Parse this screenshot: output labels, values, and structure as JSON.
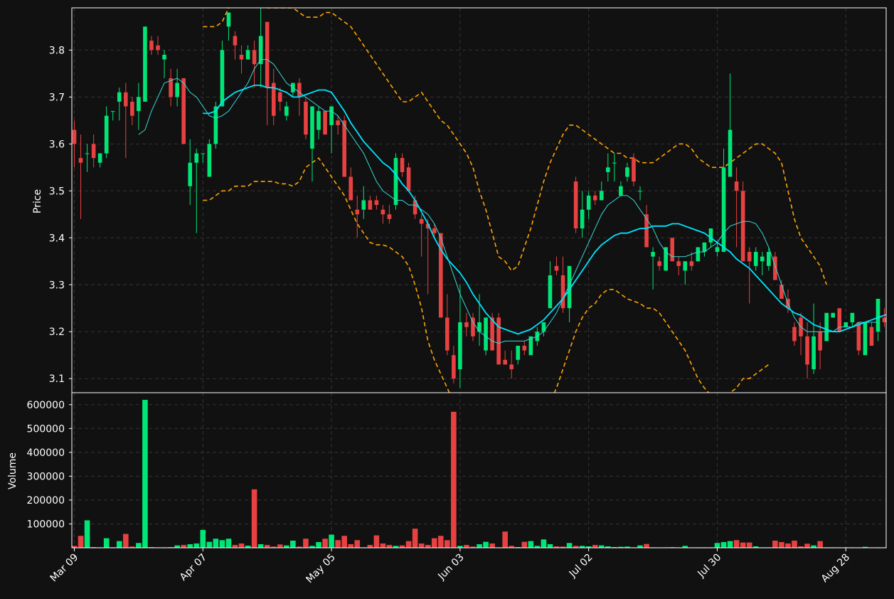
{
  "colors": {
    "background": "#111111",
    "up": "#00e676",
    "down": "#e84142",
    "ma_fast": "#38d9d9",
    "ma_slow": "#00e5ff",
    "bands": "#ffa500",
    "grid": "#333333",
    "axis": "#ffffff"
  },
  "chart_data": {
    "type": "candlestick",
    "price_panel": {
      "ylabel": "Price",
      "ylim": [
        3.07,
        3.89
      ],
      "yticks": [
        "3.1",
        "3.2",
        "3.3",
        "3.4",
        "3.5",
        "3.6",
        "3.7",
        "3.8"
      ],
      "grid": true
    },
    "volume_panel": {
      "ylabel": "Volume",
      "ylim": [
        0,
        650000
      ],
      "yticks": [
        "100000",
        "200000",
        "300000",
        "400000",
        "500000",
        "600000"
      ],
      "grid": true
    },
    "xtick_labels": [
      "Mar 09",
      "Apr 07",
      "May 05",
      "Jun 03",
      "Jul 02",
      "Jul 30",
      "Aug 28"
    ],
    "xtick_index": [
      0,
      20,
      40,
      60,
      80,
      100,
      120
    ],
    "candles": [
      [
        3.63,
        3.65,
        3.55,
        3.6
      ],
      [
        3.57,
        3.62,
        3.44,
        3.56
      ],
      [
        3.58,
        3.6,
        3.54,
        3.58
      ],
      [
        3.6,
        3.62,
        3.55,
        3.57
      ],
      [
        3.56,
        3.58,
        3.55,
        3.58
      ],
      [
        3.58,
        3.68,
        3.57,
        3.66
      ],
      [
        3.67,
        3.67,
        3.65,
        3.67
      ],
      [
        3.69,
        3.72,
        3.65,
        3.71
      ],
      [
        3.71,
        3.73,
        3.57,
        3.68
      ],
      [
        3.69,
        3.7,
        3.64,
        3.66
      ],
      [
        3.67,
        3.73,
        3.63,
        3.7
      ],
      [
        3.69,
        3.85,
        3.69,
        3.85
      ],
      [
        3.82,
        3.83,
        3.79,
        3.8
      ],
      [
        3.81,
        3.83,
        3.79,
        3.8
      ],
      [
        3.78,
        3.8,
        3.74,
        3.79
      ],
      [
        3.74,
        3.76,
        3.68,
        3.7
      ],
      [
        3.7,
        3.76,
        3.68,
        3.73
      ],
      [
        3.74,
        3.74,
        3.6,
        3.6
      ],
      [
        3.51,
        3.61,
        3.47,
        3.56
      ],
      [
        3.56,
        3.59,
        3.41,
        3.58
      ],
      [
        3.58,
        3.58,
        3.56,
        3.58
      ],
      [
        3.53,
        3.61,
        3.53,
        3.6
      ],
      [
        3.6,
        3.69,
        3.59,
        3.68
      ],
      [
        3.68,
        3.82,
        3.68,
        3.8
      ],
      [
        3.85,
        3.88,
        3.82,
        3.88
      ],
      [
        3.83,
        3.84,
        3.78,
        3.81
      ],
      [
        3.79,
        3.81,
        3.75,
        3.78
      ],
      [
        3.78,
        3.81,
        3.78,
        3.8
      ],
      [
        3.8,
        3.82,
        3.72,
        3.77
      ],
      [
        3.77,
        3.89,
        3.72,
        3.83
      ],
      [
        3.86,
        3.86,
        3.64,
        3.72
      ],
      [
        3.73,
        3.76,
        3.64,
        3.66
      ],
      [
        3.71,
        3.72,
        3.67,
        3.69
      ],
      [
        3.66,
        3.69,
        3.65,
        3.68
      ],
      [
        3.71,
        3.73,
        3.7,
        3.73
      ],
      [
        3.73,
        3.74,
        3.66,
        3.7
      ],
      [
        3.69,
        3.7,
        3.61,
        3.62
      ],
      [
        3.59,
        3.68,
        3.52,
        3.68
      ],
      [
        3.63,
        3.68,
        3.61,
        3.67
      ],
      [
        3.67,
        3.67,
        3.62,
        3.62
      ],
      [
        3.64,
        3.66,
        3.58,
        3.68
      ],
      [
        3.65,
        3.66,
        3.62,
        3.64
      ],
      [
        3.65,
        3.66,
        3.53,
        3.53
      ],
      [
        3.53,
        3.55,
        3.48,
        3.48
      ],
      [
        3.46,
        3.49,
        3.4,
        3.45
      ],
      [
        3.46,
        3.51,
        3.44,
        3.48
      ],
      [
        3.48,
        3.49,
        3.46,
        3.46
      ],
      [
        3.48,
        3.49,
        3.46,
        3.47
      ],
      [
        3.46,
        3.47,
        3.43,
        3.45
      ],
      [
        3.45,
        3.47,
        3.43,
        3.44
      ],
      [
        3.47,
        3.58,
        3.46,
        3.57
      ],
      [
        3.57,
        3.58,
        3.53,
        3.54
      ],
      [
        3.55,
        3.56,
        3.5,
        3.5
      ],
      [
        3.48,
        3.49,
        3.44,
        3.45
      ],
      [
        3.44,
        3.45,
        3.36,
        3.43
      ],
      [
        3.43,
        3.44,
        3.28,
        3.42
      ],
      [
        3.42,
        3.43,
        3.4,
        3.41
      ],
      [
        3.41,
        3.41,
        3.29,
        3.23
      ],
      [
        3.23,
        3.28,
        3.15,
        3.16
      ],
      [
        3.15,
        3.17,
        3.09,
        3.1
      ],
      [
        3.12,
        3.3,
        3.08,
        3.22
      ],
      [
        3.22,
        3.24,
        3.19,
        3.21
      ],
      [
        3.23,
        3.24,
        3.18,
        3.19
      ],
      [
        3.2,
        3.28,
        3.17,
        3.22
      ],
      [
        3.16,
        3.23,
        3.15,
        3.23
      ],
      [
        3.23,
        3.24,
        3.16,
        3.16
      ],
      [
        3.23,
        3.24,
        3.13,
        3.13
      ],
      [
        3.14,
        3.16,
        3.13,
        3.13
      ],
      [
        3.13,
        3.16,
        3.1,
        3.12
      ],
      [
        3.14,
        3.17,
        3.13,
        3.17
      ],
      [
        3.17,
        3.18,
        3.15,
        3.16
      ],
      [
        3.15,
        3.19,
        3.15,
        3.19
      ],
      [
        3.18,
        3.21,
        3.17,
        3.2
      ],
      [
        3.2,
        3.22,
        3.19,
        3.22
      ],
      [
        3.25,
        3.35,
        3.25,
        3.32
      ],
      [
        3.34,
        3.36,
        3.32,
        3.33
      ],
      [
        3.32,
        3.36,
        3.24,
        3.25
      ],
      [
        3.25,
        3.34,
        3.22,
        3.34
      ],
      [
        3.52,
        3.53,
        3.41,
        3.42
      ],
      [
        3.42,
        3.5,
        3.4,
        3.46
      ],
      [
        3.46,
        3.5,
        3.44,
        3.49
      ],
      [
        3.49,
        3.5,
        3.47,
        3.48
      ],
      [
        3.48,
        3.52,
        3.48,
        3.5
      ],
      [
        3.54,
        3.58,
        3.52,
        3.55
      ],
      [
        3.56,
        3.58,
        3.52,
        3.56
      ],
      [
        3.49,
        3.52,
        3.49,
        3.51
      ],
      [
        3.53,
        3.56,
        3.52,
        3.55
      ],
      [
        3.57,
        3.58,
        3.51,
        3.52
      ],
      [
        3.5,
        3.51,
        3.48,
        3.5
      ],
      [
        3.45,
        3.47,
        3.38,
        3.38
      ],
      [
        3.36,
        3.38,
        3.29,
        3.37
      ],
      [
        3.35,
        3.36,
        3.33,
        3.34
      ],
      [
        3.33,
        3.38,
        3.33,
        3.38
      ],
      [
        3.4,
        3.4,
        3.35,
        3.35
      ],
      [
        3.35,
        3.36,
        3.32,
        3.34
      ],
      [
        3.33,
        3.35,
        3.3,
        3.35
      ],
      [
        3.35,
        3.37,
        3.33,
        3.34
      ],
      [
        3.35,
        3.38,
        3.35,
        3.38
      ],
      [
        3.37,
        3.39,
        3.36,
        3.39
      ],
      [
        3.39,
        3.42,
        3.38,
        3.42
      ],
      [
        3.37,
        3.39,
        3.36,
        3.38
      ],
      [
        3.37,
        3.59,
        3.37,
        3.55
      ],
      [
        3.53,
        3.75,
        3.53,
        3.63
      ],
      [
        3.52,
        3.55,
        3.38,
        3.5
      ],
      [
        3.5,
        3.52,
        3.35,
        3.35
      ],
      [
        3.37,
        3.38,
        3.26,
        3.35
      ],
      [
        3.34,
        3.38,
        3.33,
        3.37
      ],
      [
        3.35,
        3.37,
        3.32,
        3.36
      ],
      [
        3.34,
        3.38,
        3.33,
        3.37
      ],
      [
        3.36,
        3.37,
        3.31,
        3.31
      ],
      [
        3.3,
        3.31,
        3.27,
        3.27
      ],
      [
        3.27,
        3.29,
        3.24,
        3.25
      ],
      [
        3.21,
        3.22,
        3.17,
        3.18
      ],
      [
        3.23,
        3.24,
        3.15,
        3.19
      ],
      [
        3.19,
        3.22,
        3.1,
        3.13
      ],
      [
        3.12,
        3.26,
        3.11,
        3.19
      ],
      [
        3.2,
        3.22,
        3.12,
        3.16
      ],
      [
        3.18,
        3.24,
        3.18,
        3.24
      ],
      [
        3.23,
        3.24,
        3.23,
        3.24
      ],
      [
        3.25,
        3.25,
        3.2,
        3.2
      ],
      [
        3.21,
        3.22,
        3.21,
        3.22
      ],
      [
        3.22,
        3.24,
        3.21,
        3.24
      ],
      [
        3.22,
        3.22,
        3.15,
        3.16
      ],
      [
        3.15,
        3.22,
        3.15,
        3.22
      ],
      [
        3.21,
        3.22,
        3.17,
        3.17
      ],
      [
        3.2,
        3.27,
        3.18,
        3.27
      ],
      [
        3.23,
        3.25,
        3.21,
        3.22
      ],
      [
        3.19,
        3.21,
        3.17,
        3.18
      ],
      [
        3.16,
        3.2,
        3.16,
        3.19
      ]
    ],
    "volume": [
      8000,
      50000,
      115000,
      3000,
      2000,
      40000,
      2000,
      28000,
      58000,
      5000,
      20000,
      620000,
      3000,
      2000,
      2000,
      3000,
      10000,
      12000,
      15000,
      18000,
      75000,
      25000,
      38000,
      32000,
      38000,
      12000,
      18000,
      9000,
      245000,
      15000,
      12000,
      5000,
      14000,
      10000,
      30000,
      5000,
      38000,
      8000,
      24000,
      38000,
      55000,
      32000,
      50000,
      15000,
      32000,
      2000,
      12000,
      52000,
      18000,
      12000,
      8000,
      10000,
      28000,
      80000,
      18000,
      12000,
      40000,
      50000,
      32000,
      570000,
      8000,
      12000,
      5000,
      15000,
      25000,
      18000,
      2000,
      68000,
      8000,
      3000,
      25000,
      28000,
      8000,
      35000,
      15000,
      6000,
      5000,
      20000,
      8000,
      8000,
      6000,
      12000,
      10000,
      6000,
      3000,
      4000,
      5000,
      2000,
      10000,
      16000,
      2000,
      2000,
      2000,
      3000,
      2000,
      8000,
      2000,
      2000,
      2000,
      2000,
      20000,
      24000,
      28000,
      32000,
      22000,
      22000,
      6000,
      2000,
      2000,
      30000,
      24000,
      18000,
      30000,
      6000,
      17000,
      10000,
      28000,
      2000,
      2000,
      2000,
      2000,
      2000,
      2000,
      4000,
      2000,
      2000,
      2000,
      2000,
      2000,
      2000
    ],
    "ma_fast": [
      null,
      null,
      null,
      null,
      null,
      null,
      null,
      null,
      null,
      null,
      3.62,
      3.63,
      3.67,
      3.7,
      3.73,
      3.735,
      3.74,
      3.73,
      3.71,
      3.7,
      3.68,
      3.66,
      3.655,
      3.66,
      3.67,
      3.69,
      3.71,
      3.73,
      3.76,
      3.78,
      3.78,
      3.77,
      3.75,
      3.73,
      3.72,
      3.71,
      3.7,
      3.69,
      3.68,
      3.67,
      3.67,
      3.66,
      3.64,
      3.62,
      3.6,
      3.58,
      3.55,
      3.52,
      3.5,
      3.49,
      3.48,
      3.48,
      3.47,
      3.47,
      3.46,
      3.45,
      3.43,
      3.4,
      3.36,
      3.32,
      3.28,
      3.25,
      3.22,
      3.2,
      3.19,
      3.18,
      3.175,
      3.18,
      3.18,
      3.18,
      3.18,
      3.185,
      3.19,
      3.2,
      3.22,
      3.24,
      3.27,
      3.3,
      3.33,
      3.36,
      3.39,
      3.42,
      3.45,
      3.47,
      3.48,
      3.49,
      3.49,
      3.48,
      3.46,
      3.44,
      3.42,
      3.39,
      3.37,
      3.36,
      3.36,
      3.36,
      3.365,
      3.37,
      3.37,
      3.38,
      3.39,
      3.41,
      3.425,
      3.43,
      3.435,
      3.435,
      3.43,
      3.41,
      3.38,
      3.34,
      3.3,
      3.26,
      3.23,
      3.21,
      3.2,
      3.2,
      3.2,
      3.2,
      3.2,
      3.21,
      3.21,
      3.21,
      3.22,
      3.22,
      3.22,
      3.22
    ],
    "ma_slow": [
      null,
      null,
      null,
      null,
      null,
      null,
      null,
      null,
      null,
      null,
      null,
      null,
      null,
      null,
      null,
      null,
      null,
      null,
      null,
      null,
      3.665,
      3.665,
      3.67,
      3.69,
      3.7,
      3.71,
      3.715,
      3.72,
      3.725,
      3.725,
      3.72,
      3.72,
      3.715,
      3.71,
      3.7,
      3.7,
      3.705,
      3.71,
      3.715,
      3.715,
      3.71,
      3.69,
      3.67,
      3.645,
      3.625,
      3.605,
      3.59,
      3.575,
      3.56,
      3.55,
      3.535,
      3.515,
      3.5,
      3.48,
      3.455,
      3.43,
      3.4,
      3.375,
      3.355,
      3.34,
      3.325,
      3.305,
      3.28,
      3.26,
      3.24,
      3.225,
      3.21,
      3.205,
      3.2,
      3.195,
      3.2,
      3.205,
      3.215,
      3.225,
      3.24,
      3.255,
      3.27,
      3.29,
      3.31,
      3.33,
      3.35,
      3.37,
      3.385,
      3.395,
      3.405,
      3.41,
      3.41,
      3.415,
      3.42,
      3.42,
      3.425,
      3.425,
      3.425,
      3.43,
      3.43,
      3.425,
      3.42,
      3.415,
      3.41,
      3.4,
      3.39,
      3.38,
      3.37,
      3.355,
      3.345,
      3.335,
      3.32,
      3.305,
      3.29,
      3.275,
      3.26,
      3.25,
      3.24,
      3.235,
      3.225,
      3.215,
      3.21,
      3.205,
      3.2,
      3.2,
      3.205,
      3.21,
      3.215,
      3.22,
      3.225,
      3.23,
      3.235,
      3.24,
      3.245,
      3.25
    ],
    "band_upper": [
      null,
      null,
      null,
      null,
      null,
      null,
      null,
      null,
      null,
      null,
      null,
      null,
      null,
      null,
      null,
      null,
      null,
      null,
      null,
      null,
      3.85,
      3.85,
      3.85,
      3.86,
      3.89,
      3.91,
      3.92,
      3.92,
      3.91,
      3.9,
      3.89,
      3.89,
      3.89,
      3.89,
      3.89,
      3.88,
      3.87,
      3.87,
      3.87,
      3.88,
      3.88,
      3.87,
      3.86,
      3.85,
      3.83,
      3.81,
      3.79,
      3.77,
      3.75,
      3.73,
      3.71,
      3.69,
      3.69,
      3.7,
      3.71,
      3.69,
      3.67,
      3.65,
      3.64,
      3.62,
      3.6,
      3.58,
      3.55,
      3.5,
      3.46,
      3.41,
      3.36,
      3.35,
      3.33,
      3.34,
      3.38,
      3.42,
      3.47,
      3.52,
      3.56,
      3.59,
      3.62,
      3.64,
      3.64,
      3.63,
      3.62,
      3.61,
      3.6,
      3.59,
      3.58,
      3.58,
      3.57,
      3.57,
      3.56,
      3.56,
      3.56,
      3.57,
      3.58,
      3.59,
      3.6,
      3.6,
      3.59,
      3.57,
      3.56,
      3.55,
      3.55,
      3.55,
      3.56,
      3.57,
      3.58,
      3.59,
      3.6,
      3.6,
      3.59,
      3.58,
      3.56,
      3.5,
      3.44,
      3.4,
      3.38,
      3.36,
      3.34,
      3.3
    ],
    "band_lower": [
      null,
      null,
      null,
      null,
      null,
      null,
      null,
      null,
      null,
      null,
      null,
      null,
      null,
      null,
      null,
      null,
      null,
      null,
      null,
      null,
      3.48,
      3.48,
      3.49,
      3.5,
      3.5,
      3.51,
      3.51,
      3.51,
      3.52,
      3.52,
      3.52,
      3.52,
      3.515,
      3.515,
      3.51,
      3.52,
      3.55,
      3.56,
      3.57,
      3.55,
      3.53,
      3.51,
      3.49,
      3.46,
      3.43,
      3.41,
      3.39,
      3.385,
      3.385,
      3.38,
      3.37,
      3.36,
      3.34,
      3.3,
      3.25,
      3.18,
      3.14,
      3.11,
      3.08,
      3.05,
      3.02,
      3.0,
      2.98,
      2.96,
      2.94,
      2.92,
      2.92,
      2.93,
      2.94,
      2.95,
      2.96,
      2.97,
      3.0,
      3.02,
      3.05,
      3.08,
      3.12,
      3.16,
      3.2,
      3.23,
      3.25,
      3.26,
      3.28,
      3.29,
      3.29,
      3.28,
      3.27,
      3.265,
      3.26,
      3.25,
      3.25,
      3.24,
      3.22,
      3.2,
      3.18,
      3.16,
      3.13,
      3.1,
      3.08,
      3.065,
      3.06,
      3.06,
      3.07,
      3.08,
      3.1,
      3.1,
      3.11,
      3.12,
      3.13
    ]
  }
}
